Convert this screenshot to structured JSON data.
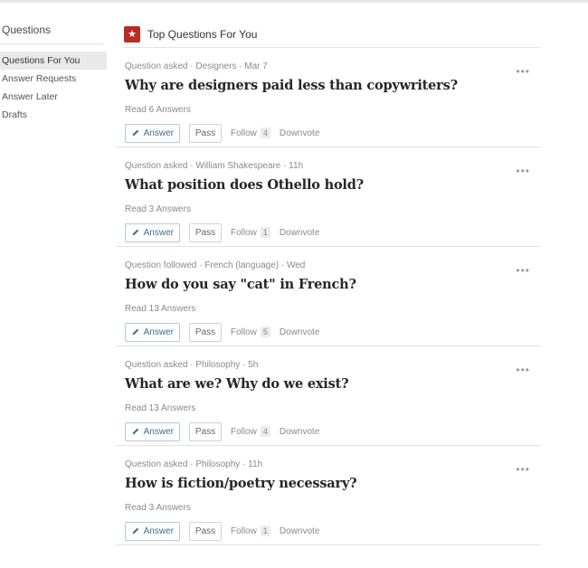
{
  "sidebar": {
    "title": "Questions",
    "items": [
      {
        "label": "Questions For You",
        "active": true
      },
      {
        "label": "Answer Requests",
        "active": false
      },
      {
        "label": "Answer Later",
        "active": false
      },
      {
        "label": "Drafts",
        "active": false
      }
    ]
  },
  "feed": {
    "title": "Top Questions For You",
    "icon": "star-icon",
    "accent": "#b92b27"
  },
  "questions": [
    {
      "meta": "Question asked · Designers · Mar 7",
      "title": "Why are designers paid less than copywriters?",
      "read": "Read 6 Answers",
      "answer_label": "Answer",
      "pass_label": "Pass",
      "follow_label": "Follow",
      "follow_count": "4",
      "downvote_label": "Downvote",
      "more_label": "•••"
    },
    {
      "meta": "Question asked · William Shakespeare · 11h",
      "title": "What position does Othello hold?",
      "read": "Read 3 Answers",
      "answer_label": "Answer",
      "pass_label": "Pass",
      "follow_label": "Follow",
      "follow_count": "1",
      "downvote_label": "Downvote",
      "more_label": "•••"
    },
    {
      "meta": "Question followed · French (language) · Wed",
      "title": "How do you say \"cat\" in French?",
      "read": "Read 13 Answers",
      "answer_label": "Answer",
      "pass_label": "Pass",
      "follow_label": "Follow",
      "follow_count": "5",
      "downvote_label": "Downvote",
      "more_label": "•••"
    },
    {
      "meta": "Question asked · Philosophy · 5h",
      "title": "What are we? Why do we exist?",
      "read": "Read 13 Answers",
      "answer_label": "Answer",
      "pass_label": "Pass",
      "follow_label": "Follow",
      "follow_count": "4",
      "downvote_label": "Downvote",
      "more_label": "•••"
    },
    {
      "meta": "Question asked · Philosophy · 11h",
      "title": "How is fiction/poetry necessary?",
      "read": "Read 3 Answers",
      "answer_label": "Answer",
      "pass_label": "Pass",
      "follow_label": "Follow",
      "follow_count": "1",
      "downvote_label": "Downvote",
      "more_label": "•••"
    }
  ]
}
